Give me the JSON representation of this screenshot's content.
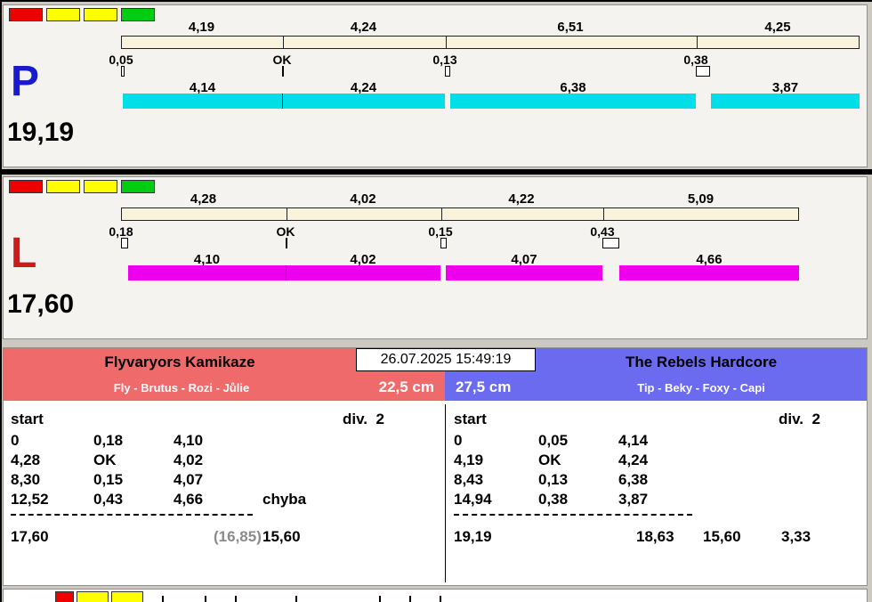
{
  "datetime": "26.07.2025 15:49:19",
  "colors": {
    "cyan_bar": "#00dee8",
    "magenta_bar": "#ee00ee",
    "cream_bar": "#f8f4dc",
    "left_team_header": "#ef6b6b",
    "right_team_header": "#6b6bef",
    "p_letter": "#1a1acd",
    "l_letter": "#cd1a1a",
    "light_red": "#ee0000",
    "light_yellow": "#ffff00",
    "light_green": "#00cc11"
  },
  "lanes": [
    {
      "id": "P",
      "total": "19,19",
      "lights": [
        "red",
        "yellow",
        "yellow",
        "green"
      ],
      "splits": [
        "4,19",
        "4,24",
        "6,51",
        "4,25"
      ],
      "changes": [
        "0,05",
        "OK",
        "0,13",
        "0,38"
      ],
      "dog_times": [
        "4,14",
        "4,24",
        "6,38",
        "3,87"
      ]
    },
    {
      "id": "L",
      "total": "17,60",
      "lights": [
        "red",
        "yellow",
        "yellow",
        "green"
      ],
      "splits": [
        "4,28",
        "4,02",
        "4,22",
        "5,09"
      ],
      "changes": [
        "0,18",
        "OK",
        "0,15",
        "0,43"
      ],
      "dog_times": [
        "4,10",
        "4,02",
        "4,07",
        "4,66"
      ]
    }
  ],
  "teams": [
    {
      "name": "Flyvaryors Kamikaze",
      "dogs": "Fly - Brutus - Rozi - Jůlie",
      "jump_height": "22,5 cm",
      "start_label": "start",
      "division": "div.  2",
      "rows": [
        [
          "0",
          "0,18",
          "4,10",
          ""
        ],
        [
          "4,28",
          "OK",
          "4,02",
          ""
        ],
        [
          "8,30",
          "0,15",
          "4,07",
          ""
        ],
        [
          "12,52",
          "0,43",
          "4,66",
          "chyba"
        ]
      ],
      "result": "17,60",
      "secondary": "(16,85)",
      "best": "15,60",
      "diff": ""
    },
    {
      "name": "The Rebels Hardcore",
      "dogs": "Tip - Beky - Foxy - Capi",
      "jump_height": "27,5 cm",
      "start_label": "start",
      "division": "div.  2",
      "rows": [
        [
          "0",
          "0,05",
          "4,14",
          ""
        ],
        [
          "4,19",
          "OK",
          "4,24",
          ""
        ],
        [
          "8,43",
          "0,13",
          "6,38",
          ""
        ],
        [
          "14,94",
          "0,38",
          "3,87",
          ""
        ]
      ],
      "result": "19,19",
      "secondary": "18,63",
      "best": "15,60",
      "diff": "3,33"
    }
  ],
  "bottom_strip": {
    "lights": [
      "red",
      "yellow",
      "yellow"
    ]
  }
}
